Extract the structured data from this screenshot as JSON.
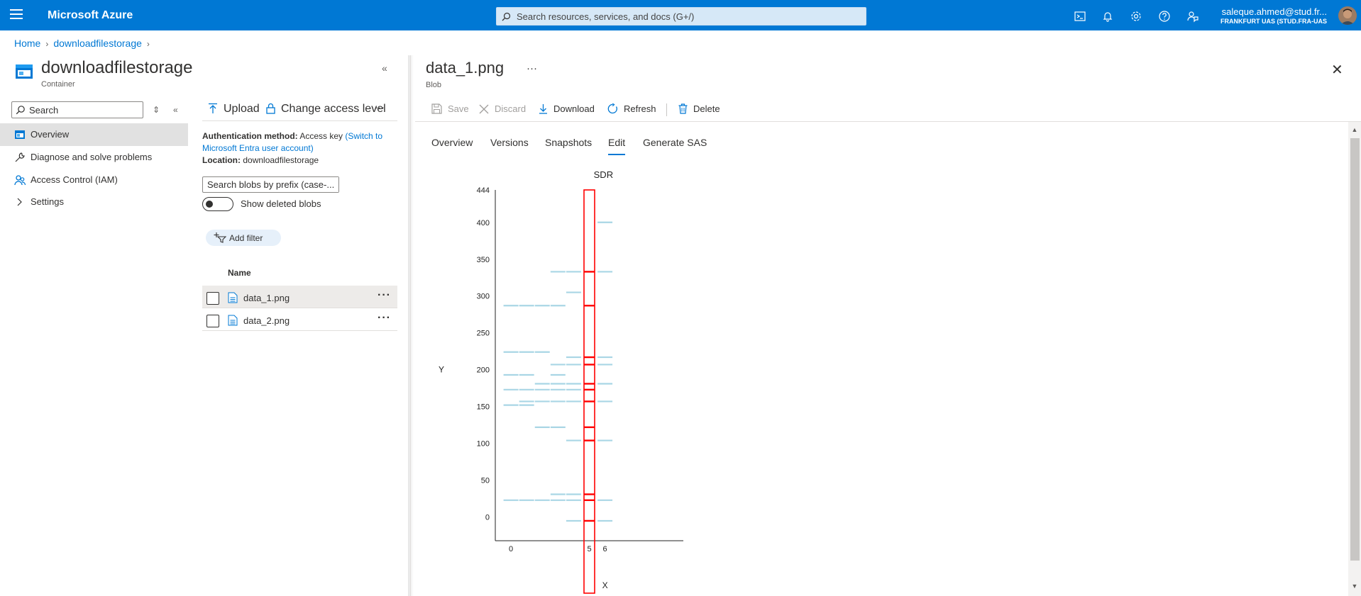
{
  "topbar": {
    "brand": "Microsoft Azure",
    "search_placeholder": "Search resources, services, and docs (G+/)",
    "account_user": "saleque.ahmed@stud.fr...",
    "account_org": "FRANKFURT UAS (STUD.FRA-UAS...",
    "icons": [
      "cloud-shell-icon",
      "bell-icon",
      "gear-icon",
      "help-icon",
      "feedback-icon"
    ]
  },
  "breadcrumb": {
    "home": "Home",
    "container": "downloadfilestorage"
  },
  "container": {
    "title": "downloadfilestorage",
    "subtitle": "Container"
  },
  "nav": {
    "search_placeholder": "Search",
    "items": [
      {
        "label": "Overview",
        "icon": "overview-icon",
        "active": true
      },
      {
        "label": "Diagnose and solve problems",
        "icon": "wrench-icon"
      },
      {
        "label": "Access Control (IAM)",
        "icon": "people-icon"
      },
      {
        "label": "Settings",
        "icon": "chevron-right-icon"
      }
    ]
  },
  "list_panel": {
    "toolbar": {
      "upload": "Upload",
      "change_access": "Change access level"
    },
    "auth_label": "Authentication method:",
    "auth_value": "Access key",
    "auth_link": "(Switch to Microsoft Entra user account)",
    "location_label": "Location:",
    "location_value": "downloadfilestorage",
    "blob_search_placeholder": "Search blobs by prefix (case-...",
    "show_deleted": "Show deleted blobs",
    "add_filter": "Add filter",
    "column_name": "Name",
    "rows": [
      {
        "name": "data_1.png",
        "selected": true
      },
      {
        "name": "data_2.png",
        "selected": false
      }
    ]
  },
  "blob": {
    "title": "data_1.png",
    "subtitle": "Blob",
    "toolbar": {
      "save": "Save",
      "discard": "Discard",
      "download": "Download",
      "refresh": "Refresh",
      "delete": "Delete"
    },
    "tabs": [
      "Overview",
      "Versions",
      "Snapshots",
      "Edit",
      "Generate SAS"
    ],
    "active_tab": "Edit"
  },
  "chart_data": {
    "type": "scatter",
    "title": "SDR",
    "xlabel": "X",
    "ylabel": "Y",
    "x_ticks": [
      "0",
      "5",
      "6"
    ],
    "y_ticks": [
      "0",
      "50",
      "100",
      "150",
      "200",
      "250",
      "300",
      "350",
      "400",
      "444"
    ],
    "colors": {
      "background_segments": "#a9d6e5",
      "highlight": "#ff0000"
    },
    "background_segments": [
      {
        "x": 6,
        "y": 400
      },
      {
        "x": 3,
        "y": 333
      },
      {
        "x": 4,
        "y": 333
      },
      {
        "x": 6,
        "y": 333
      },
      {
        "x": 4,
        "y": 305
      },
      {
        "x": 0,
        "y": 287
      },
      {
        "x": 1,
        "y": 287
      },
      {
        "x": 2,
        "y": 287
      },
      {
        "x": 3,
        "y": 287
      },
      {
        "x": 0,
        "y": 224
      },
      {
        "x": 1,
        "y": 224
      },
      {
        "x": 2,
        "y": 224
      },
      {
        "x": 4,
        "y": 217
      },
      {
        "x": 6,
        "y": 217
      },
      {
        "x": 3,
        "y": 207
      },
      {
        "x": 4,
        "y": 207
      },
      {
        "x": 6,
        "y": 207
      },
      {
        "x": 0,
        "y": 193
      },
      {
        "x": 1,
        "y": 193
      },
      {
        "x": 3,
        "y": 193
      },
      {
        "x": 2,
        "y": 181
      },
      {
        "x": 3,
        "y": 181
      },
      {
        "x": 4,
        "y": 181
      },
      {
        "x": 6,
        "y": 181
      },
      {
        "x": 0,
        "y": 173
      },
      {
        "x": 1,
        "y": 173
      },
      {
        "x": 2,
        "y": 173
      },
      {
        "x": 3,
        "y": 173
      },
      {
        "x": 4,
        "y": 173
      },
      {
        "x": 1,
        "y": 157
      },
      {
        "x": 2,
        "y": 157
      },
      {
        "x": 3,
        "y": 157
      },
      {
        "x": 4,
        "y": 157
      },
      {
        "x": 6,
        "y": 157
      },
      {
        "x": 0,
        "y": 152
      },
      {
        "x": 1,
        "y": 152
      },
      {
        "x": 2,
        "y": 122
      },
      {
        "x": 3,
        "y": 122
      },
      {
        "x": 4,
        "y": 104
      },
      {
        "x": 6,
        "y": 104
      },
      {
        "x": 3,
        "y": 31
      },
      {
        "x": 4,
        "y": 31
      },
      {
        "x": 0,
        "y": 23
      },
      {
        "x": 1,
        "y": 23
      },
      {
        "x": 2,
        "y": 23
      },
      {
        "x": 3,
        "y": 23
      },
      {
        "x": 4,
        "y": 23
      },
      {
        "x": 6,
        "y": 23
      },
      {
        "x": 4,
        "y": -5
      },
      {
        "x": 6,
        "y": -5
      }
    ],
    "highlight_column_x": 5,
    "highlight_segments_y": [
      333,
      287,
      217,
      207,
      181,
      173,
      157,
      122,
      104,
      31,
      23,
      -5
    ],
    "ylim": [
      -32,
      444
    ],
    "xlim": [
      -1,
      11
    ]
  }
}
